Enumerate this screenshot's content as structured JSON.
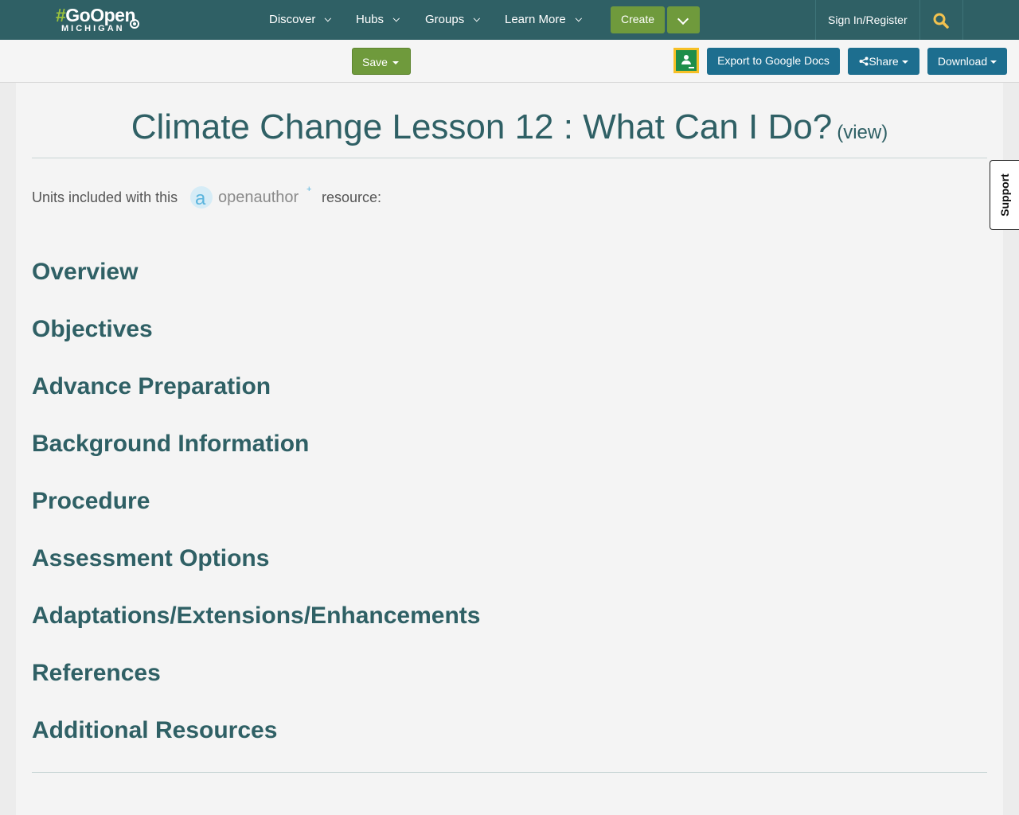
{
  "nav": {
    "logo_hash": "#",
    "logo_main": "GoOpen",
    "logo_sub": "MICHIGAN",
    "items": [
      {
        "label": "Discover"
      },
      {
        "label": "Hubs"
      },
      {
        "label": "Groups"
      },
      {
        "label": "Learn More"
      }
    ],
    "create_label": "Create",
    "signin_label": "Sign In/Register",
    "search_icon": "search-icon"
  },
  "toolbar": {
    "save_label": "Save",
    "classroom_icon": "google-classroom-icon",
    "export_label": "Export to Google Docs",
    "share_label": "Share",
    "download_label": "Download"
  },
  "main": {
    "title": "Climate Change Lesson 12 : What Can I Do?",
    "view_link": "(view)",
    "units_prefix": "Units included with this",
    "units_logo": "openauthor",
    "units_suffix": "resource:",
    "sections": [
      {
        "label": "Overview"
      },
      {
        "label": "Objectives"
      },
      {
        "label": "Advance Preparation"
      },
      {
        "label": "Background Information"
      },
      {
        "label": "Procedure"
      },
      {
        "label": "Assessment Options"
      },
      {
        "label": "Adaptations/Extensions/Enhancements"
      },
      {
        "label": "References"
      },
      {
        "label": "Additional Resources"
      }
    ]
  },
  "support": {
    "label": "Support"
  },
  "colors": {
    "nav_bg": "#2f6065",
    "green": "#6f9a3c",
    "blue": "#1d6e8f",
    "heading": "#2f6065",
    "search_icon": "#f2c24f"
  }
}
